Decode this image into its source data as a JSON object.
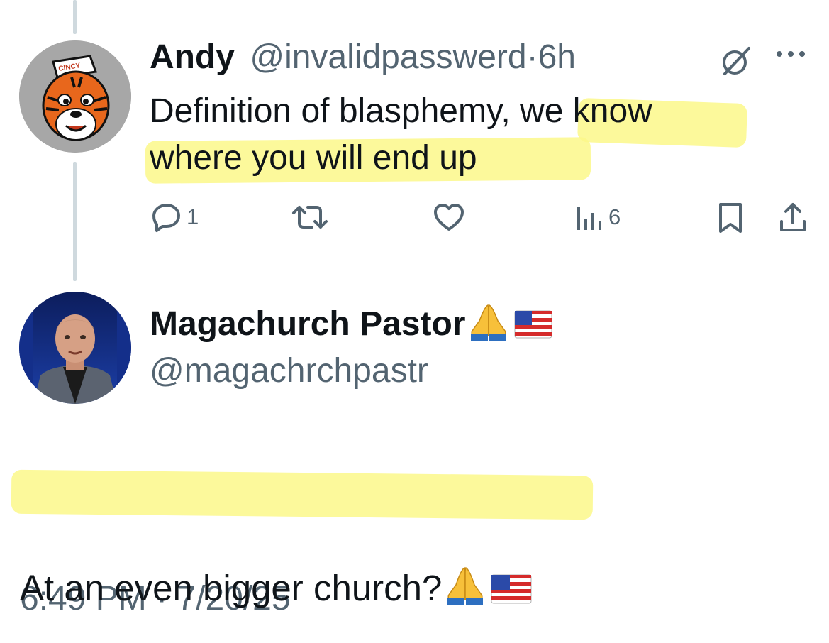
{
  "reply": {
    "author_name": "Andy",
    "author_handle": "@invalidpasswerd",
    "separator": "·",
    "time_ago": "6h",
    "text_line1": "Definition of blasphemy, we know",
    "text_line2": "where you will end up",
    "actions": {
      "reply_count": "1",
      "retweet_count": "",
      "like_count": "",
      "view_count": "6"
    },
    "avatar_text": "CINCY"
  },
  "main": {
    "author_name": "Magachurch Pastor",
    "author_handle": "@magachrchpastr",
    "text": "At an even bigger church?",
    "timestamp": "6:49 PM · 7/20/25"
  },
  "colors": {
    "text": "#0f1419",
    "secondary": "#536471",
    "highlight": "#fbf88a",
    "thread_line": "#cfd9de"
  },
  "icons": [
    "grok-icon",
    "more-icon",
    "reply-icon",
    "retweet-icon",
    "like-icon",
    "views-icon",
    "bookmark-icon",
    "share-icon",
    "praying-hands-emoji",
    "us-flag-emoji"
  ]
}
